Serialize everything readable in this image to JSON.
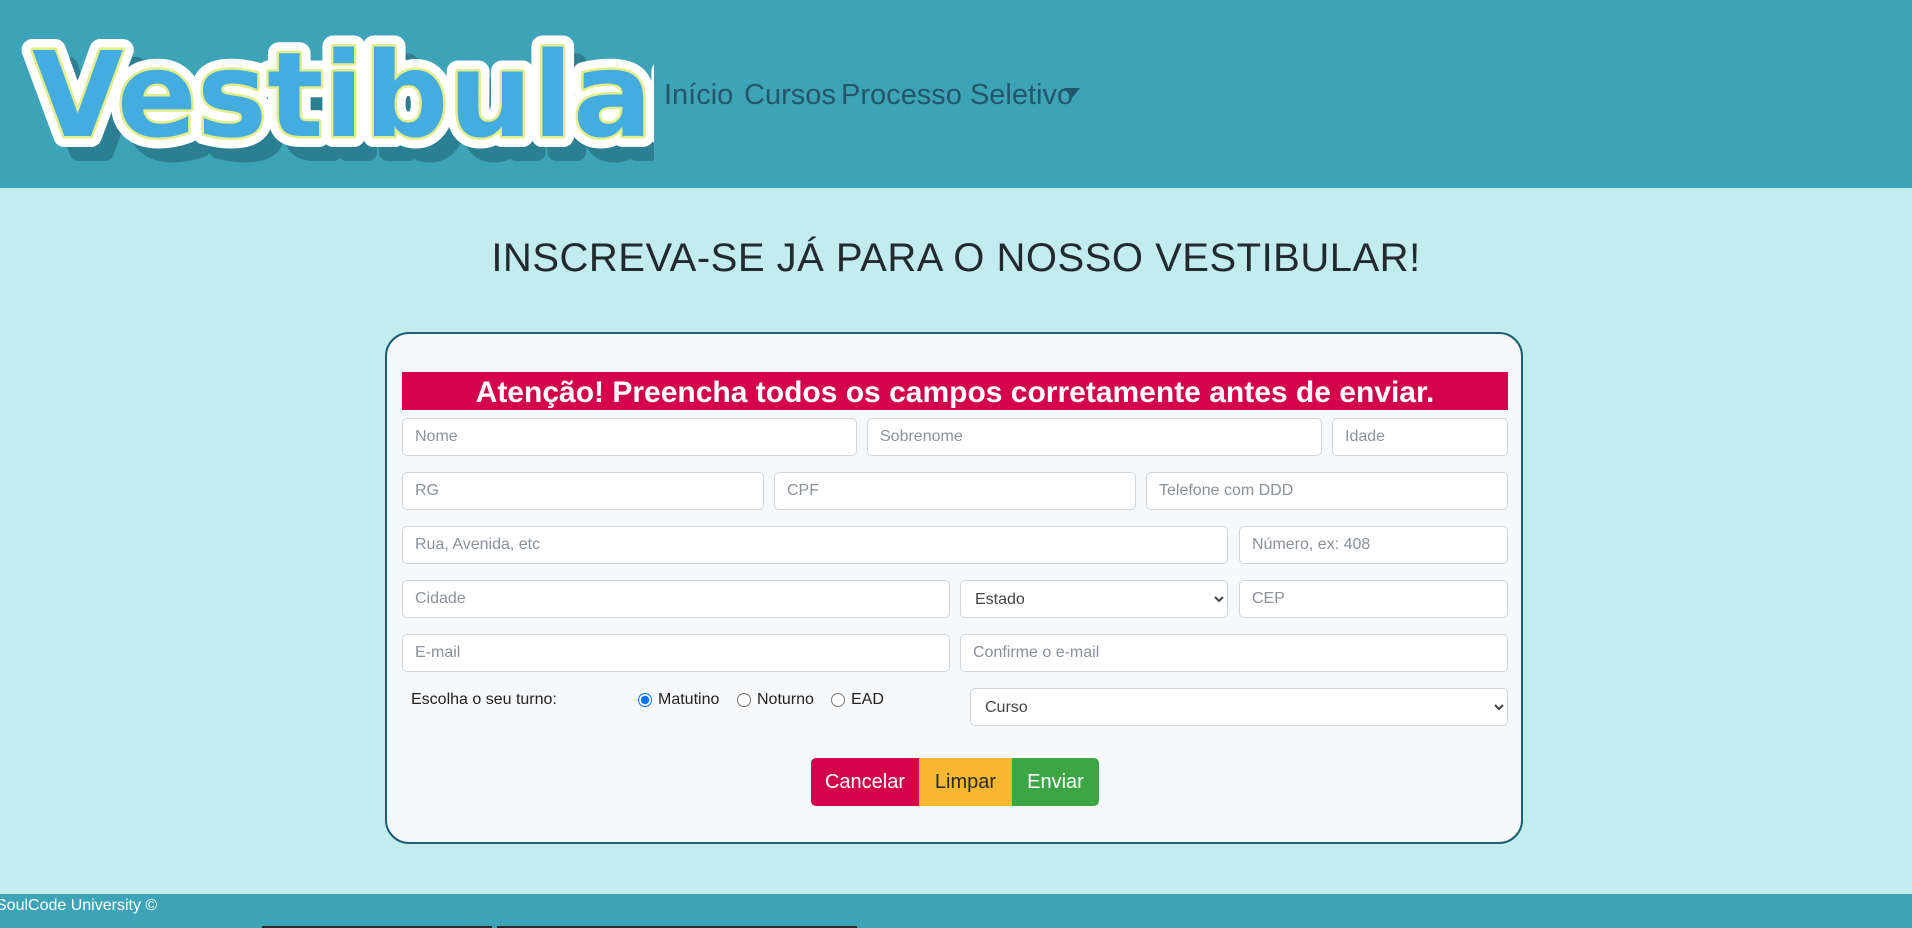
{
  "header": {
    "logo_text": "Vestibular",
    "nav": [
      "Início",
      "Cursos",
      "Processo Seletivo"
    ]
  },
  "main": {
    "title": "INSCREVA-SE JÁ PARA O NOSSO VESTIBULAR!",
    "alert": "Atenção! Preencha todos os campos corretamente antes de enviar."
  },
  "form": {
    "placeholders": {
      "nome": "Nome",
      "sobrenome": "Sobrenome",
      "idade": "Idade",
      "rg": "RG",
      "cpf": "CPF",
      "telefone": "Telefone com DDD",
      "rua": "Rua, Avenida, etc",
      "numero": "Número, ex: 408",
      "cidade": "Cidade",
      "cep": "CEP",
      "email": "E-mail",
      "confirm_email": "Confirme o e-mail"
    },
    "estado_selected": "Estado",
    "curso_selected": "Curso",
    "turno_label": "Escolha o seu turno:",
    "turnos": [
      "Matutino",
      "Noturno",
      "EAD"
    ],
    "turno_checked": "Matutino",
    "buttons": {
      "cancel": "Cancelar",
      "clear": "Limpar",
      "send": "Enviar"
    }
  },
  "footer": {
    "text": "SoulCode University ©"
  },
  "colors": {
    "header_bg": "#3da4b7",
    "page_bg": "#c3ecef",
    "alert": "#d4024a",
    "cancel": "#d4024a",
    "clear": "#f7b731",
    "send": "#3ca647"
  }
}
